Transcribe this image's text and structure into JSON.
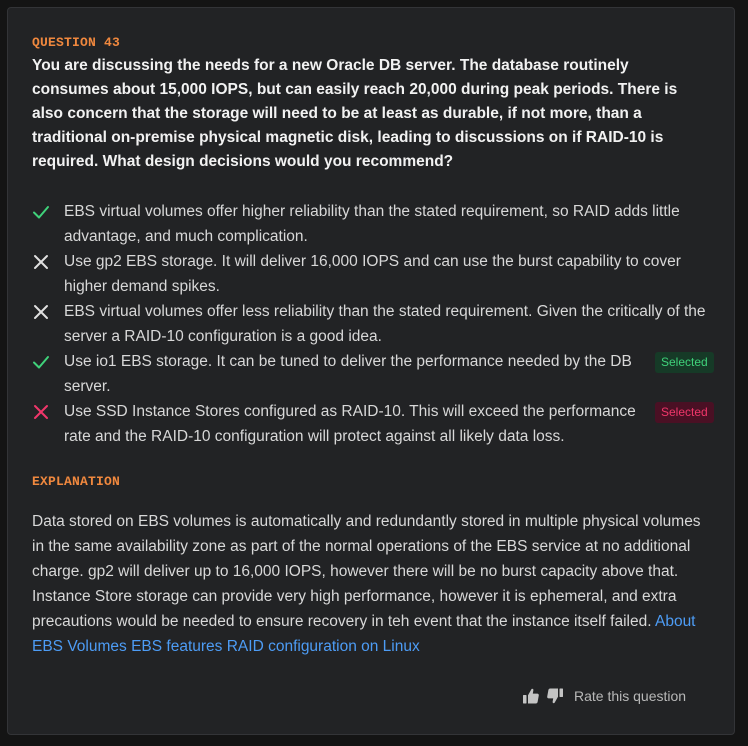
{
  "question": {
    "label": "QUESTION 43",
    "text": "You are discussing the needs for a new Oracle DB server. The database routinely consumes about 15,000 IOPS, but can easily reach 20,000 during peak periods. There is also concern that the storage will need to be at least as durable, if not more, than a traditional on-premise physical magnetic disk, leading to discussions on if RAID-10 is required. What design decisions would you recommend?"
  },
  "options": [
    {
      "text": "EBS virtual volumes offer higher reliability than the stated requirement, so RAID adds little advantage, and much complication.",
      "mark": "check",
      "badge": ""
    },
    {
      "text": "Use gp2 EBS storage. It will deliver 16,000 IOPS and can use the burst capability to cover higher demand spikes.",
      "mark": "cross",
      "badge": ""
    },
    {
      "text": "EBS virtual volumes offer less reliability than the stated requirement. Given the critically of the server a RAID-10 configuration is a good idea.",
      "mark": "cross",
      "badge": ""
    },
    {
      "text": "Use io1 EBS storage. It can be tuned to deliver the performance needed by the DB server.",
      "mark": "check",
      "badge": "Selected"
    },
    {
      "text": "Use SSD Instance Stores configured as RAID-10. This will exceed the performance rate and the RAID-10 configuration will protect against all likely data loss.",
      "mark": "cross-red",
      "badge": "Selected"
    }
  ],
  "explanation": {
    "label": "EXPLANATION",
    "text": "Data stored on EBS volumes is automatically and redundantly stored in multiple physical volumes in the same availability zone as part of the normal operations of the EBS service at no additional charge. gp2 will deliver up to 16,000 IOPS, however there will be no burst capacity above that. Instance Store storage can provide very high performance, however it is ephemeral, and extra precautions would be needed to ensure recovery in teh event that the instance itself failed.",
    "links": [
      "About EBS Volumes",
      "EBS features",
      "RAID configuration on Linux"
    ]
  },
  "rating": {
    "label": "Rate this question",
    "up_icon": "thumbs-up-icon",
    "down_icon": "thumbs-down-icon"
  },
  "colors": {
    "accent_orange": "#f0883e",
    "correct_green": "#3fd27a",
    "wrong_red": "#f0366a",
    "link_blue": "#4d9cf5"
  }
}
